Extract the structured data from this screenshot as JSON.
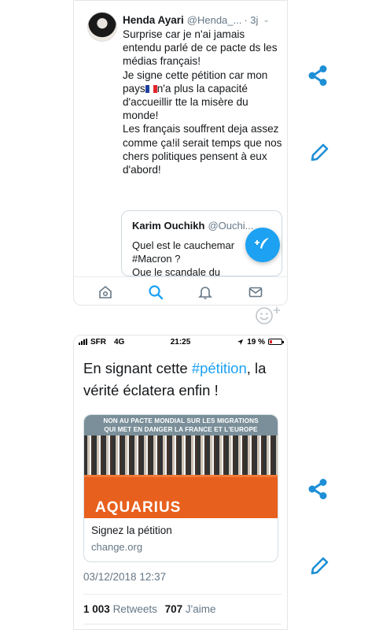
{
  "colors": {
    "accent": "#1da1f2",
    "share": "#1e8fd6",
    "ship_hull": "#e8601e"
  },
  "top_tweet": {
    "author_name": "Henda Ayari",
    "author_handle": "@Henda_...",
    "time": "· 3j",
    "text_before_flag": "Surprise car je n'ai jamais entendu parlé de ce pacte ds les médias français!\nJe signe cette pétition car mon pays",
    "text_after_flag": "n'a plus la capacité d'accueillir tte la misère du monde!\nLes français souffrent deja assez comme ça!il serait temps que nos chers politiques pensent à eux d'abord!",
    "quote": {
      "author_name": "Karim Ouchikh",
      "author_handle": "@Ouchi...",
      "text": "Quel est le cauchemar\n#Macron ?\nQue le scandale du"
    }
  },
  "tabbar": {
    "items": [
      {
        "icon": "home-icon"
      },
      {
        "icon": "search-icon"
      },
      {
        "icon": "bell-icon"
      },
      {
        "icon": "mail-icon"
      }
    ]
  },
  "status_bar": {
    "carrier": "SFR",
    "network": "4G",
    "time": "21:25",
    "battery": "19 %"
  },
  "bottom_tweet": {
    "text_before": "En signant cette ",
    "hashtag": "#pétition",
    "text_after": ", la vérité éclatera enfin !",
    "card": {
      "banner": "NON AU PACTE MONDIAL SUR LES MIGRATIONS\nQUI MET EN DANGER LA FRANCE ET L'EUROPE",
      "ship_name": "AQUARIUS",
      "title": "Signez la pétition",
      "domain": "change.org"
    },
    "date": "03/12/2018 12:37",
    "retweets_count": "1 003",
    "retweets_label": "Retweets",
    "likes_count": "707",
    "likes_label": "J'aime"
  }
}
